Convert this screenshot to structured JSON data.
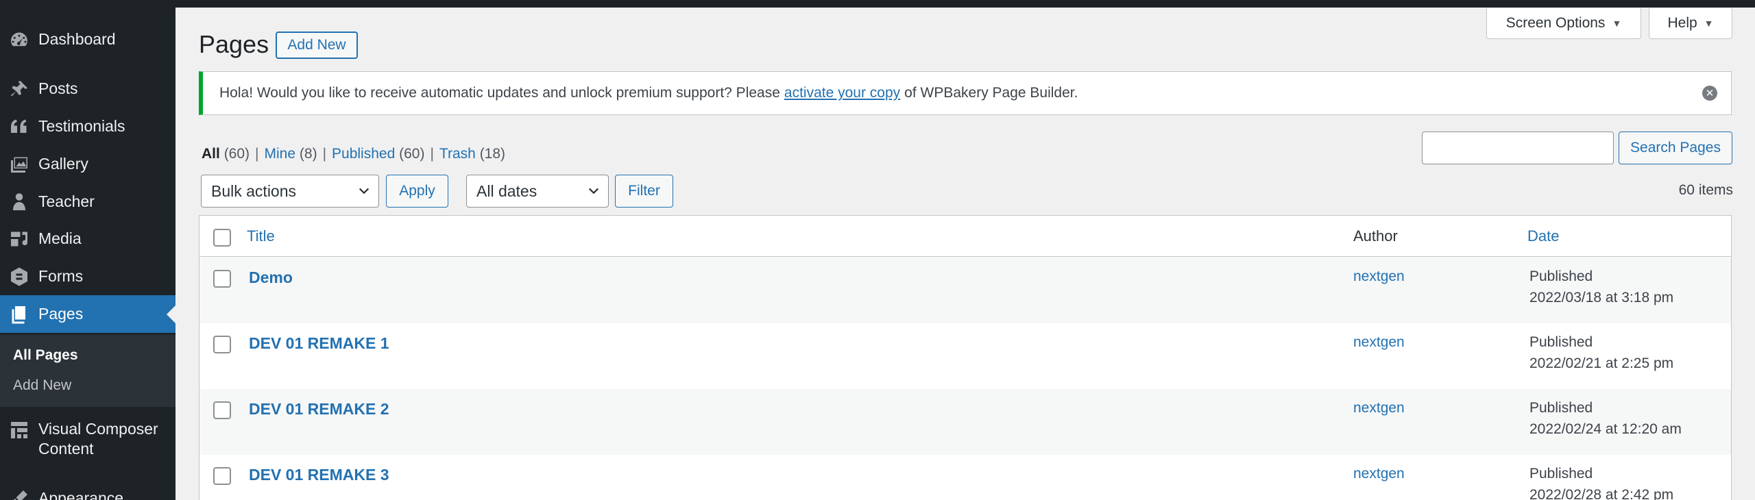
{
  "sidebar": {
    "items": [
      {
        "name": "dashboard",
        "label": "Dashboard",
        "icon": "dashboard-icon"
      },
      {
        "name": "posts",
        "label": "Posts",
        "icon": "pin-icon"
      },
      {
        "name": "testimonials",
        "label": "Testimonials",
        "icon": "quote-icon"
      },
      {
        "name": "gallery",
        "label": "Gallery",
        "icon": "images-icon"
      },
      {
        "name": "teacher",
        "label": "Teacher",
        "icon": "person-icon"
      },
      {
        "name": "media",
        "label": "Media",
        "icon": "media-icon"
      },
      {
        "name": "forms",
        "label": "Forms",
        "icon": "forms-icon"
      },
      {
        "name": "pages",
        "label": "Pages",
        "icon": "pages-icon"
      },
      {
        "name": "visual-composer",
        "label": "Visual Composer",
        "label2": "Content",
        "icon": "grid-icon"
      },
      {
        "name": "appearance",
        "label": "Appearance",
        "icon": "brush-icon"
      }
    ],
    "submenu": {
      "all_pages": "All Pages",
      "add_new": "Add New"
    }
  },
  "header": {
    "title": "Pages",
    "add_new": "Add New",
    "screen_options": "Screen Options",
    "help": "Help"
  },
  "notice": {
    "text_before": "Hola! Would you like to receive automatic updates and unlock premium support? Please",
    "link": "activate your copy",
    "text_after": "of WPBakery Page Builder."
  },
  "filters": {
    "all": "All",
    "all_count": "(60)",
    "mine": "Mine",
    "mine_count": "(8)",
    "published": "Published",
    "published_count": "(60)",
    "trash": "Trash",
    "trash_count": "(18)",
    "sep": "|"
  },
  "search": {
    "button": "Search Pages",
    "value": ""
  },
  "bulk": {
    "selected": "Bulk actions",
    "apply": "Apply"
  },
  "dates": {
    "selected": "All dates",
    "filter": "Filter"
  },
  "items_count": "60 items",
  "table": {
    "columns": {
      "title": "Title",
      "author": "Author",
      "date": "Date"
    },
    "rows": [
      {
        "title": "Demo",
        "author": "nextgen",
        "status": "Published",
        "date": "2022/03/18 at 3:18 pm"
      },
      {
        "title": "DEV 01 REMAKE 1",
        "author": "nextgen",
        "status": "Published",
        "date": "2022/02/21 at 2:25 pm"
      },
      {
        "title": "DEV 01 REMAKE 2",
        "author": "nextgen",
        "status": "Published",
        "date": "2022/02/24 at 12:20 am"
      },
      {
        "title": "DEV 01 REMAKE 3",
        "author": "nextgen",
        "status": "Published",
        "date": "2022/02/28 at 2:42 pm"
      }
    ]
  },
  "colors": {
    "accent": "#2271b1",
    "sidebar_bg": "#1d2327",
    "notice_border": "#00a32a"
  }
}
